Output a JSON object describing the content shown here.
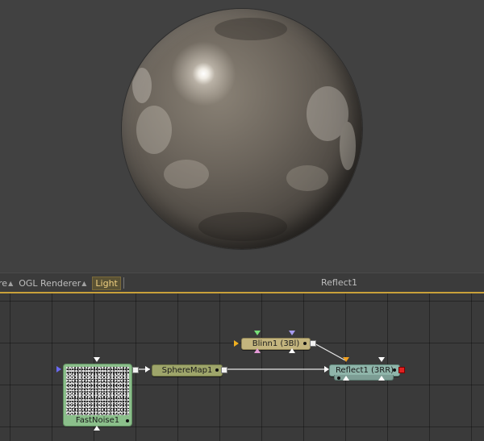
{
  "viewer": {
    "content": "rendered sphere"
  },
  "toolbar": {
    "cut_label": "re",
    "ogl_label": "OGL Renderer",
    "light_label": "Light",
    "view_label": "Reflect1"
  },
  "flow": {
    "nodes": {
      "blinn": "Blinn1  (3Bl)",
      "spheremap": "SphereMap1",
      "reflect": "Reflect1  (3RR)",
      "fastnoise": "FastNoise1"
    }
  },
  "colors": {
    "accent": "#c9a03a",
    "blinn": "#c4b57e",
    "spheremap": "#9ea56a",
    "reflect": "#8fb5aa",
    "fastnoise": "#8bbf8b"
  }
}
